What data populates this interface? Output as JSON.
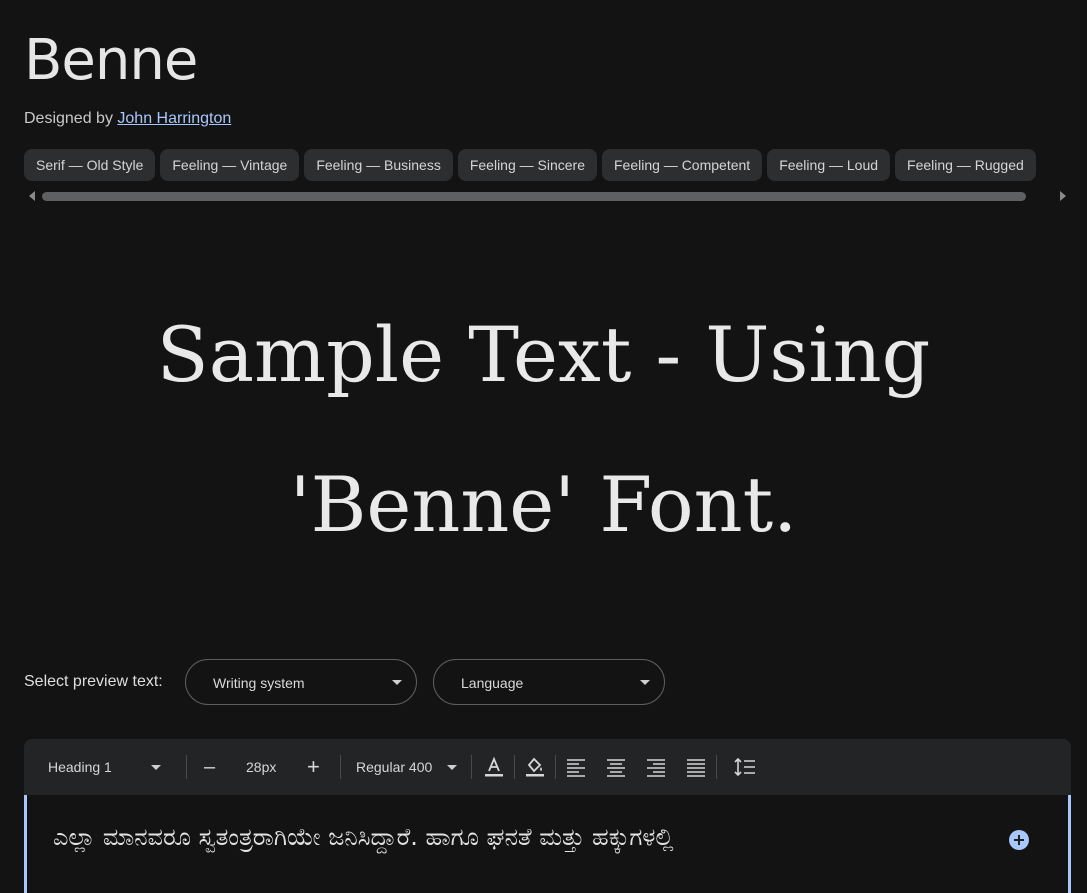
{
  "font": {
    "name": "Benne",
    "designed_by_prefix": "Designed by",
    "designer": "John Harrington"
  },
  "tags": [
    "Serif — Old Style",
    "Feeling — Vintage",
    "Feeling — Business",
    "Feeling — Sincere",
    "Feeling — Competent",
    "Feeling — Loud",
    "Feeling — Rugged"
  ],
  "sample_text": "Sample Text - Using 'Benne' Font.",
  "preview": {
    "label": "Select preview text:",
    "writing_system_placeholder": "Writing system",
    "language_placeholder": "Language"
  },
  "toolbar": {
    "style": "Heading 1",
    "decrease": "–",
    "font_size": "28px",
    "increase": "+",
    "weight": "Regular 400"
  },
  "editor": {
    "text": "ಎಲ್ಲಾ ಮಾನವರೂ ಸ್ವತಂತ್ರರಾಗಿಯೇ ಜನಿಸಿದ್ದಾರೆ. ಹಾಗೂ ಘನತೆ ಮತ್ತು ಹಕ್ಕುಗಳಲ್ಲಿ"
  },
  "colors": {
    "background": "#131313",
    "chip": "#2d2e30",
    "link": "#a8c7fa",
    "accent": "#a8c7fa"
  }
}
